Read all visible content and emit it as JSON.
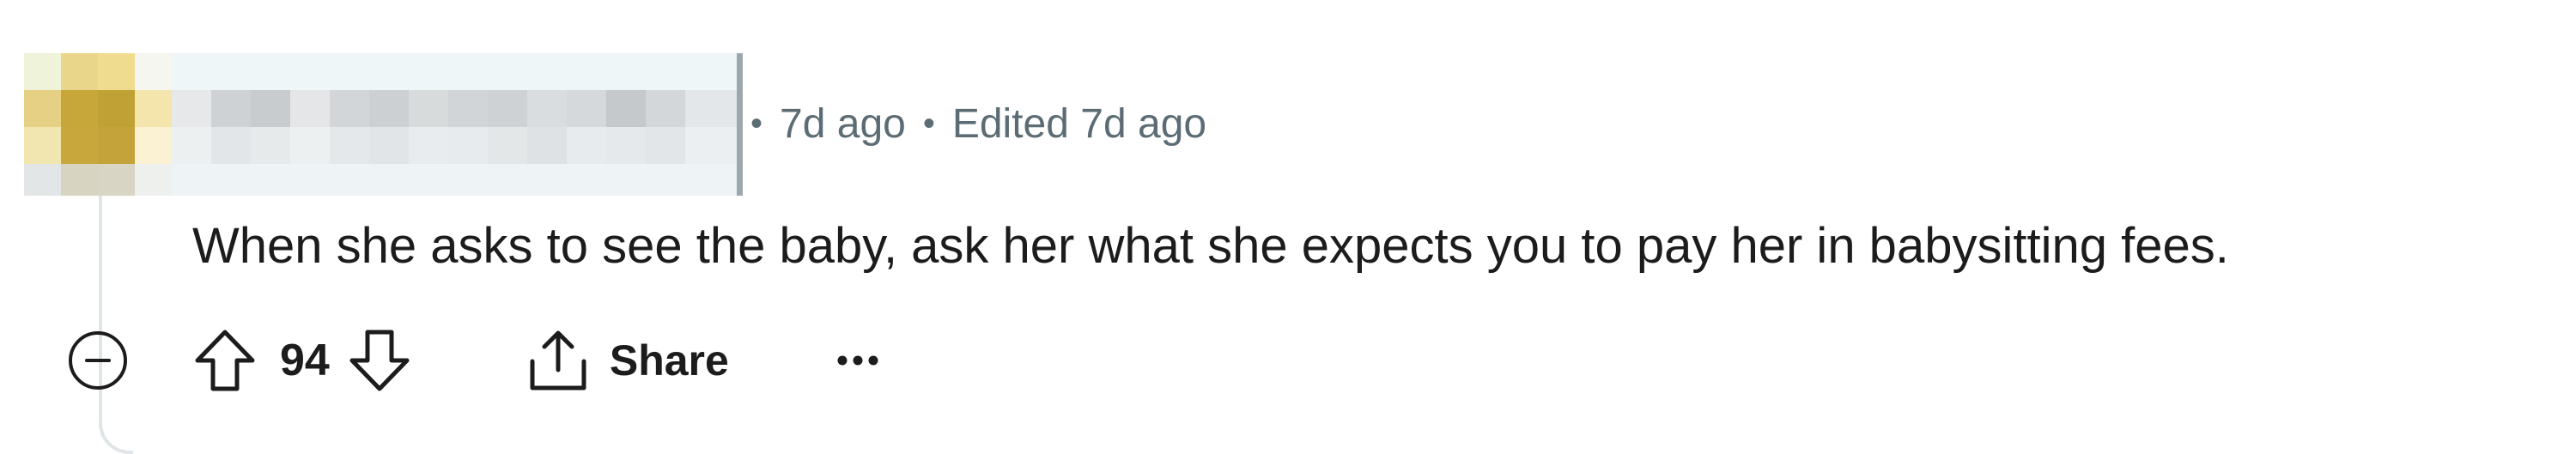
{
  "comment": {
    "meta": {
      "separator": "•",
      "posted": "7d ago",
      "edited": "Edited 7d ago"
    },
    "body": "When she asks to see the baby, ask her what she expects you to pay her in babysitting fees.",
    "votes": {
      "count": "94"
    },
    "actions": {
      "share_label": "Share"
    },
    "icons": {
      "collapse": "collapse-minus-icon",
      "upvote": "upvote-arrow-icon",
      "downvote": "downvote-arrow-icon",
      "share": "share-icon",
      "more": "more-dots-icon"
    }
  }
}
